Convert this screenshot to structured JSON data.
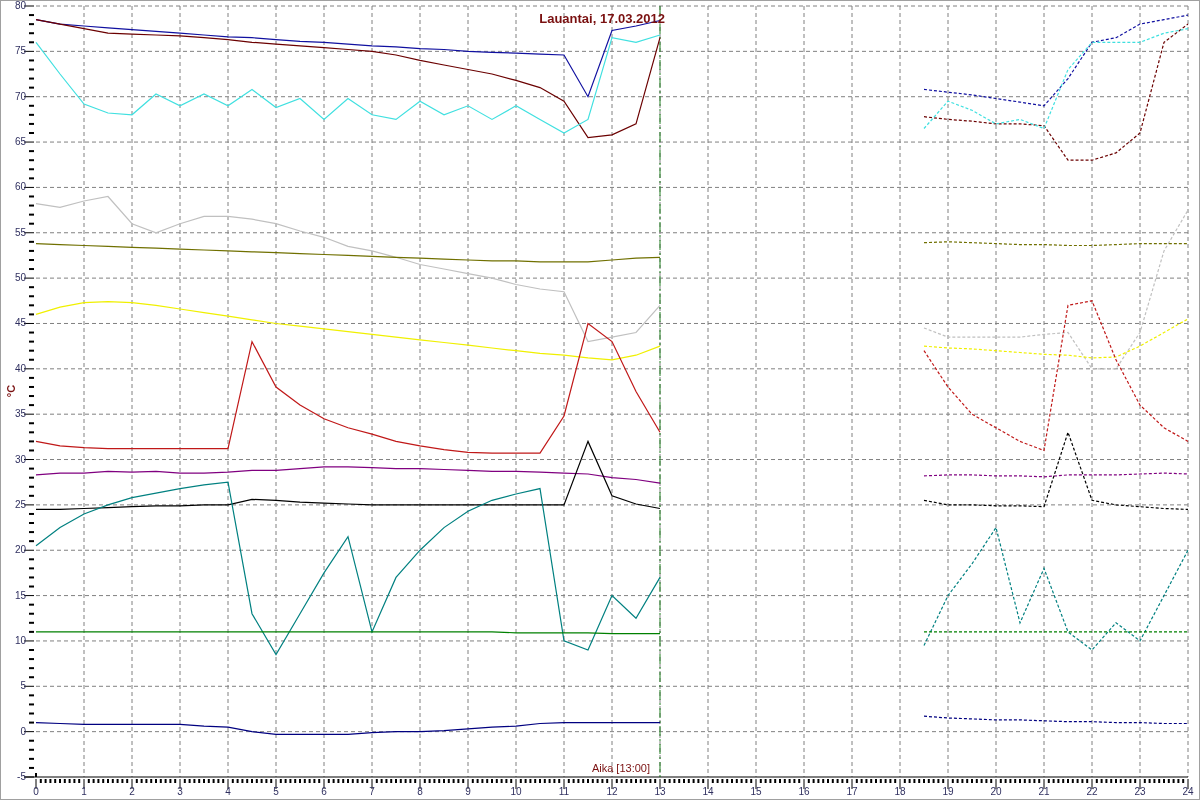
{
  "chart": {
    "chart_data": {
      "type": "line",
      "title": "Lauantai, 17.03.2012",
      "ylabel": "°C",
      "x": [
        0,
        0.5,
        1,
        1.5,
        2,
        2.5,
        3,
        3.5,
        4,
        4.5,
        5,
        5.5,
        6,
        6.5,
        7,
        7.5,
        8,
        8.5,
        9,
        9.5,
        10,
        10.5,
        11,
        11.5,
        12,
        12.5,
        13,
        13.5,
        14,
        14.5,
        15,
        15.5,
        16,
        16.5,
        17,
        17.5,
        18,
        18.5,
        19,
        19.5,
        20,
        20.5,
        21,
        21.5,
        22,
        22.5,
        23,
        23.5,
        24
      ],
      "xlim": [
        0,
        24
      ],
      "ylim": [
        -5,
        80
      ],
      "xticks": [
        0,
        1,
        2,
        3,
        4,
        5,
        6,
        7,
        8,
        9,
        10,
        11,
        12,
        13,
        14,
        15,
        16,
        17,
        18,
        19,
        20,
        21,
        22,
        23,
        24
      ],
      "yticks": [
        -5,
        0,
        5,
        10,
        15,
        20,
        25,
        30,
        35,
        40,
        45,
        50,
        55,
        60,
        65,
        70,
        75,
        80
      ],
      "grid": true,
      "ref_lines": [
        {
          "axis": "x",
          "value": 13,
          "label": "Aika [13:00]",
          "color": "#208020"
        }
      ],
      "series": [
        {
          "color": "#1010a0",
          "values": [
            78.5,
            78,
            77.8,
            77.6,
            77.4,
            77.2,
            77,
            76.8,
            76.6,
            76.5,
            76.3,
            76.1,
            76,
            75.8,
            75.6,
            75.5,
            75.3,
            75.2,
            75,
            74.9,
            74.8,
            74.7,
            74.6,
            70,
            77.3,
            77.8,
            78.4,
            null,
            null,
            null,
            null,
            null,
            null,
            null,
            null,
            null,
            null,
            70.8,
            70.5,
            70.2,
            69.8,
            69.4,
            69,
            72,
            76,
            76.5,
            78,
            78.5,
            79
          ]
        },
        {
          "color": "#6b0000",
          "values": [
            78.5,
            78,
            77.5,
            77,
            76.9,
            76.8,
            76.7,
            76.5,
            76.3,
            76,
            75.8,
            75.6,
            75.4,
            75.2,
            75,
            74.6,
            74,
            73.5,
            73,
            72.5,
            71.8,
            71,
            69.5,
            65.5,
            65.8,
            67,
            76.5,
            null,
            null,
            null,
            null,
            null,
            null,
            null,
            null,
            null,
            null,
            67.8,
            67.5,
            67.3,
            67,
            67,
            66.8,
            63,
            63,
            63.8,
            66,
            76,
            78
          ]
        },
        {
          "color": "#40e0e0",
          "values": [
            76,
            72.5,
            69.2,
            68.2,
            68,
            70.3,
            69,
            70.3,
            69,
            70.8,
            68.8,
            69.8,
            67.5,
            69.8,
            68,
            67.5,
            69.5,
            68,
            69,
            67.5,
            69,
            67.5,
            66,
            67.5,
            76.5,
            76,
            76.8,
            null,
            null,
            null,
            null,
            null,
            null,
            null,
            null,
            null,
            null,
            66.5,
            69.5,
            68.5,
            67,
            67.5,
            66.5,
            73,
            76,
            76,
            76,
            77,
            77.5
          ]
        },
        {
          "color": "#c0c0c0",
          "values": [
            58.2,
            57.8,
            58.5,
            59,
            56,
            55,
            56,
            56.8,
            56.8,
            56.5,
            56,
            55.2,
            54.5,
            53.5,
            53,
            52.3,
            51.5,
            51,
            50.5,
            50,
            49.3,
            48.8,
            48.5,
            43,
            43.5,
            44,
            47,
            null,
            null,
            null,
            null,
            null,
            null,
            null,
            null,
            null,
            null,
            44.5,
            43.5,
            43.5,
            43.5,
            43.5,
            43.8,
            44,
            40,
            40,
            44,
            53,
            57.5
          ]
        },
        {
          "color": "#707000",
          "values": [
            53.8,
            53.7,
            53.6,
            53.5,
            53.4,
            53.3,
            53.2,
            53.1,
            53,
            52.9,
            52.8,
            52.7,
            52.6,
            52.5,
            52.4,
            52.3,
            52.2,
            52.1,
            52,
            51.9,
            51.9,
            51.8,
            51.8,
            51.8,
            52,
            52.2,
            52.3,
            null,
            null,
            null,
            null,
            null,
            null,
            null,
            null,
            null,
            null,
            53.9,
            54,
            53.9,
            53.8,
            53.7,
            53.7,
            53.6,
            53.6,
            53.7,
            53.8,
            53.8,
            53.8
          ]
        },
        {
          "color": "#f0f000",
          "values": [
            46,
            46.8,
            47.3,
            47.4,
            47.3,
            47,
            46.6,
            46.2,
            45.8,
            45.4,
            45,
            44.7,
            44.4,
            44.1,
            43.8,
            43.5,
            43.2,
            42.9,
            42.6,
            42.3,
            42,
            41.7,
            41.5,
            41.2,
            41,
            41.5,
            42.5,
            null,
            null,
            null,
            null,
            null,
            null,
            null,
            null,
            null,
            null,
            42.5,
            42.3,
            42.2,
            42,
            41.8,
            41.6,
            41.5,
            41.2,
            41.3,
            42.5,
            44,
            45.5
          ]
        },
        {
          "color": "#c01818",
          "values": [
            32,
            31.5,
            31.3,
            31.2,
            31.2,
            31.2,
            31.2,
            31.2,
            31.2,
            43,
            38,
            36,
            34.5,
            33.5,
            32.8,
            32,
            31.5,
            31.1,
            30.8,
            30.7,
            30.7,
            30.7,
            34.8,
            45,
            43,
            37.5,
            33,
            null,
            null,
            null,
            null,
            null,
            null,
            null,
            null,
            null,
            null,
            42,
            38,
            35,
            33.5,
            32,
            31,
            47,
            47.5,
            41,
            36,
            33.5,
            32
          ]
        },
        {
          "color": "#800080",
          "values": [
            28.3,
            28.5,
            28.5,
            28.7,
            28.6,
            28.7,
            28.5,
            28.5,
            28.6,
            28.8,
            28.8,
            29,
            29.2,
            29.2,
            29.1,
            29,
            29,
            28.9,
            28.8,
            28.7,
            28.7,
            28.6,
            28.5,
            28.4,
            28,
            27.8,
            27.4,
            null,
            null,
            null,
            null,
            null,
            null,
            null,
            null,
            null,
            null,
            28.2,
            28.3,
            28.3,
            28.2,
            28.2,
            28.1,
            28.3,
            28.3,
            28.3,
            28.4,
            28.5,
            28.4
          ]
        },
        {
          "color": "#000000",
          "values": [
            24.5,
            24.5,
            24.6,
            24.7,
            24.8,
            24.9,
            24.9,
            25,
            25,
            25.6,
            25.5,
            25.3,
            25.2,
            25.1,
            25,
            25,
            25,
            25,
            25,
            25,
            25,
            25,
            25,
            32,
            26,
            25.1,
            24.6,
            null,
            null,
            null,
            null,
            null,
            null,
            null,
            null,
            null,
            null,
            25.5,
            25,
            25,
            24.9,
            24.9,
            24.8,
            33,
            25.5,
            25,
            24.8,
            24.6,
            24.5
          ]
        },
        {
          "color": "#008080",
          "values": [
            20.5,
            22.5,
            24,
            25,
            25.8,
            26.3,
            26.8,
            27.2,
            27.5,
            13,
            8.5,
            13,
            17.5,
            21.5,
            11,
            17,
            20,
            22.5,
            24.3,
            25.5,
            26.2,
            26.8,
            10,
            9,
            15,
            12.5,
            17,
            null,
            null,
            null,
            null,
            null,
            null,
            null,
            null,
            null,
            null,
            9.5,
            15,
            18.5,
            22.5,
            12,
            18,
            11,
            9,
            12,
            10,
            15,
            20
          ]
        },
        {
          "color": "#008000",
          "values": [
            11,
            11,
            11,
            11,
            11,
            11,
            11,
            11,
            11,
            11,
            11,
            11,
            11,
            11,
            11,
            11,
            11,
            11,
            11,
            11,
            10.9,
            10.9,
            10.9,
            10.9,
            10.8,
            10.8,
            10.8,
            null,
            null,
            null,
            null,
            null,
            null,
            null,
            null,
            null,
            null,
            11,
            11,
            11,
            11,
            11,
            11,
            11,
            11,
            11,
            11,
            11,
            11
          ]
        },
        {
          "color": "#000080",
          "values": [
            1,
            0.9,
            0.8,
            0.8,
            0.8,
            0.8,
            0.8,
            0.6,
            0.5,
            0,
            -0.3,
            -0.3,
            -0.3,
            -0.3,
            -0.1,
            0,
            0,
            0.1,
            0.3,
            0.5,
            0.6,
            0.9,
            1,
            1,
            1,
            1,
            1,
            null,
            null,
            null,
            null,
            null,
            null,
            null,
            null,
            null,
            null,
            1.7,
            1.5,
            1.4,
            1.3,
            1.3,
            1.2,
            1.1,
            1.1,
            1,
            1,
            0.9,
            0.9
          ]
        }
      ]
    }
  }
}
